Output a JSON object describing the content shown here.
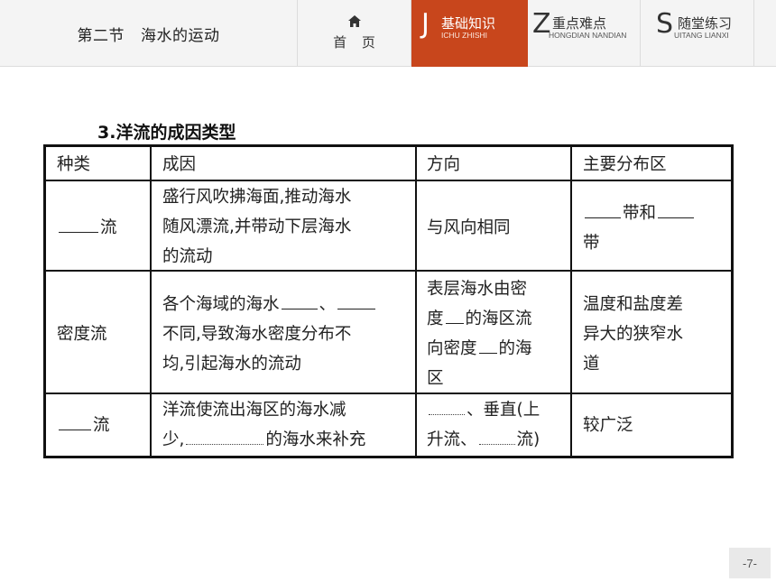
{
  "header": {
    "section_number": "第二节",
    "section_title": "海水的运动",
    "home_label": "首 页",
    "tabs": [
      {
        "letter": "J",
        "label": "基础知识",
        "pinyin": "ICHU ZHISHI"
      },
      {
        "letter": "Z",
        "label": "重点难点",
        "pinyin": "HONGDIAN NANDIAN"
      },
      {
        "letter": "S",
        "label": "随堂练习",
        "pinyin": "UITANG LIANXI"
      }
    ],
    "active_color": "#c8461c"
  },
  "heading": {
    "number": "3",
    "text": ".洋流的成因类型"
  },
  "table": {
    "headers": [
      "种类",
      "成因",
      "方向",
      "主要分布区"
    ],
    "rows": [
      {
        "type": "流",
        "cause": [
          "盛行风吹拂海面,推动海水",
          "随风漂流,并带动下层海水",
          "的流动"
        ],
        "direction": "与风向相同",
        "region_part1": "带和",
        "region_part2": "带"
      },
      {
        "type": "密度流",
        "cause_line1_prefix": "各个海域的海水",
        "cause_line1_sep": "、",
        "cause_rest": [
          "不同,导致海水密度分布不",
          "均,引起海水的流动"
        ],
        "direction_lines": [
          "表层海水由密",
          "度",
          "的海区流",
          "向密度",
          "的海",
          "区"
        ],
        "region": [
          "温度和盐度差",
          "异大的狭窄水",
          "道"
        ]
      },
      {
        "type": "流",
        "cause_line1": "洋流使流出海区的海水减",
        "cause_line2_prefix": "少,",
        "cause_line2_suffix": "的海水来补充",
        "direction_sep": "、垂直(上",
        "direction_line2_prefix": "升流、",
        "direction_line2_suffix": "流)",
        "region": "较广泛"
      }
    ]
  },
  "page_number": "-7-"
}
